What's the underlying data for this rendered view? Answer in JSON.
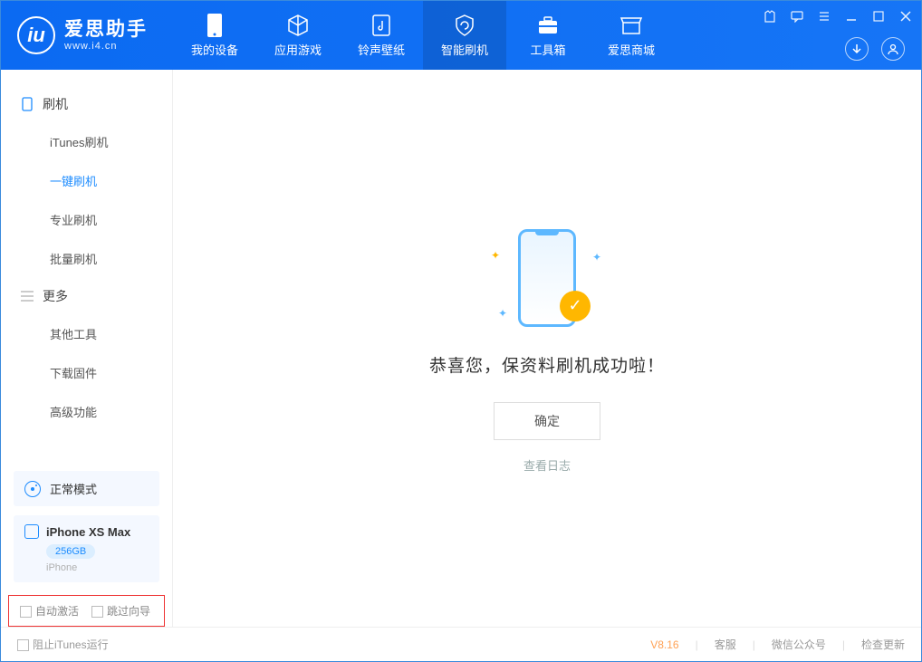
{
  "app": {
    "name": "爱思助手",
    "url": "www.i4.cn"
  },
  "tabs": [
    {
      "label": "我的设备"
    },
    {
      "label": "应用游戏"
    },
    {
      "label": "铃声壁纸"
    },
    {
      "label": "智能刷机"
    },
    {
      "label": "工具箱"
    },
    {
      "label": "爱思商城"
    }
  ],
  "sidebar": {
    "section1": {
      "title": "刷机",
      "items": [
        "iTunes刷机",
        "一键刷机",
        "专业刷机",
        "批量刷机"
      ]
    },
    "section2": {
      "title": "更多",
      "items": [
        "其他工具",
        "下载固件",
        "高级功能"
      ]
    }
  },
  "mode": {
    "label": "正常模式"
  },
  "device": {
    "name": "iPhone XS Max",
    "storage": "256GB",
    "type": "iPhone"
  },
  "bottom_options": {
    "auto_activate": "自动激活",
    "skip_guide": "跳过向导"
  },
  "main": {
    "success_text": "恭喜您，保资料刷机成功啦！",
    "ok_button": "确定",
    "view_log": "查看日志"
  },
  "footer": {
    "block_itunes": "阻止iTunes运行",
    "version": "V8.16",
    "customer_service": "客服",
    "wechat": "微信公众号",
    "check_update": "检查更新"
  }
}
